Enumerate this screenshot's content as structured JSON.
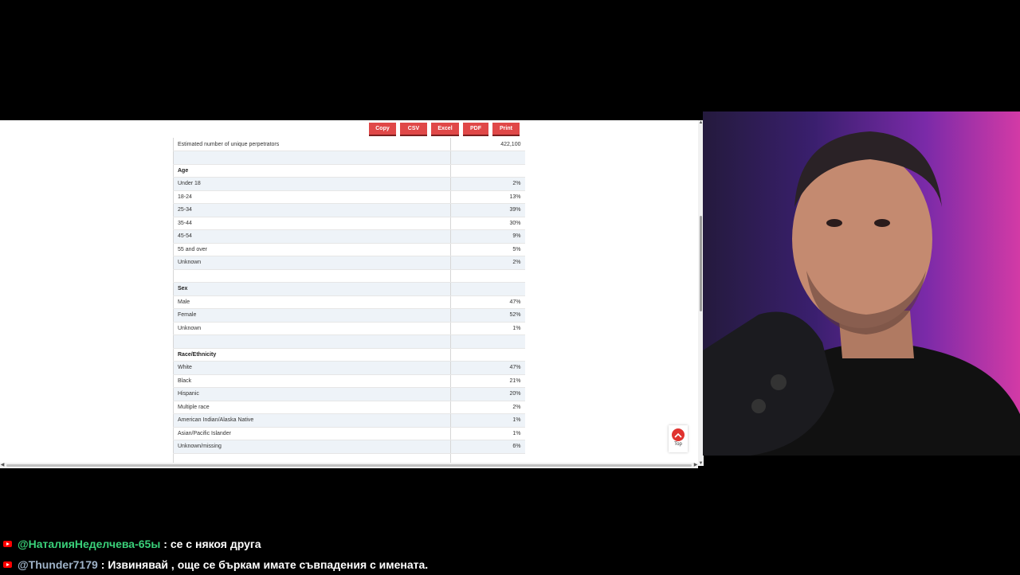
{
  "toolbar": {
    "buttons": [
      "Copy",
      "CSV",
      "Excel",
      "PDF",
      "Print"
    ]
  },
  "table": {
    "rows": [
      {
        "label": "Estimated number of unique perpetrators",
        "value": "422,100",
        "type": "row"
      },
      {
        "label": "",
        "value": "",
        "type": "blank"
      },
      {
        "label": "Age",
        "value": "",
        "type": "head"
      },
      {
        "label": "Under 18",
        "value": "2%",
        "type": "row"
      },
      {
        "label": "18-24",
        "value": "13%",
        "type": "row"
      },
      {
        "label": "25-34",
        "value": "39%",
        "type": "row"
      },
      {
        "label": "35-44",
        "value": "30%",
        "type": "row"
      },
      {
        "label": "45-54",
        "value": "9%",
        "type": "row"
      },
      {
        "label": "55 and over",
        "value": "5%",
        "type": "row"
      },
      {
        "label": "Unknown",
        "value": "2%",
        "type": "row"
      },
      {
        "label": "",
        "value": "",
        "type": "blank"
      },
      {
        "label": "Sex",
        "value": "",
        "type": "head"
      },
      {
        "label": "Male",
        "value": "47%",
        "type": "row"
      },
      {
        "label": "Female",
        "value": "52%",
        "type": "row"
      },
      {
        "label": "Unknown",
        "value": "1%",
        "type": "row"
      },
      {
        "label": "",
        "value": "",
        "type": "blank"
      },
      {
        "label": "Race/Ethnicity",
        "value": "",
        "type": "head"
      },
      {
        "label": "White",
        "value": "47%",
        "type": "row"
      },
      {
        "label": "Black",
        "value": "21%",
        "type": "row"
      },
      {
        "label": "Hispanic",
        "value": "20%",
        "type": "row"
      },
      {
        "label": "Multiple race",
        "value": "2%",
        "type": "row"
      },
      {
        "label": "American Indian/Alaska Native",
        "value": "1%",
        "type": "row"
      },
      {
        "label": "Asian/Pacific Islander",
        "value": "1%",
        "type": "row"
      },
      {
        "label": "Unknown/missing",
        "value": "6%",
        "type": "row"
      },
      {
        "label": "",
        "value": "",
        "type": "blank"
      }
    ]
  },
  "top_button": {
    "label": "Top",
    "icon": "chevron-up-icon"
  },
  "chat": {
    "messages": [
      {
        "user": "@НаталияНеделчева-65ы",
        "text": ": се с някоя друга"
      },
      {
        "user": "@Thunder7179",
        "text": ": Извинявай , още се бъркам имате съвпадения с имената."
      }
    ]
  },
  "colors": {
    "button_red": "#e04848",
    "row_alt": "#eef3f8",
    "chat_user1": "#3ad17a",
    "chat_user2": "#9fb3c8"
  }
}
